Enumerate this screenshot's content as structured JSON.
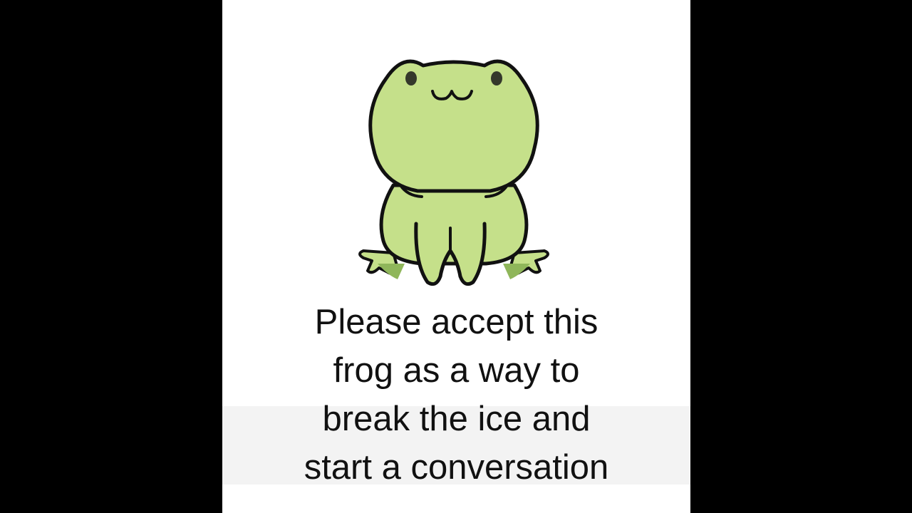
{
  "caption": {
    "line1": "Please accept this",
    "line2": "frog as a way to",
    "line3": "break the ice and",
    "line4": "start a conversation"
  },
  "colors": {
    "letterbox": "#000000",
    "background": "#ffffff",
    "frog_body": "#c5e08a",
    "frog_feet_shadow": "#8fb65a",
    "outline": "#111111"
  },
  "illustration": {
    "subject": "frog",
    "icon": "frog-illustration"
  }
}
